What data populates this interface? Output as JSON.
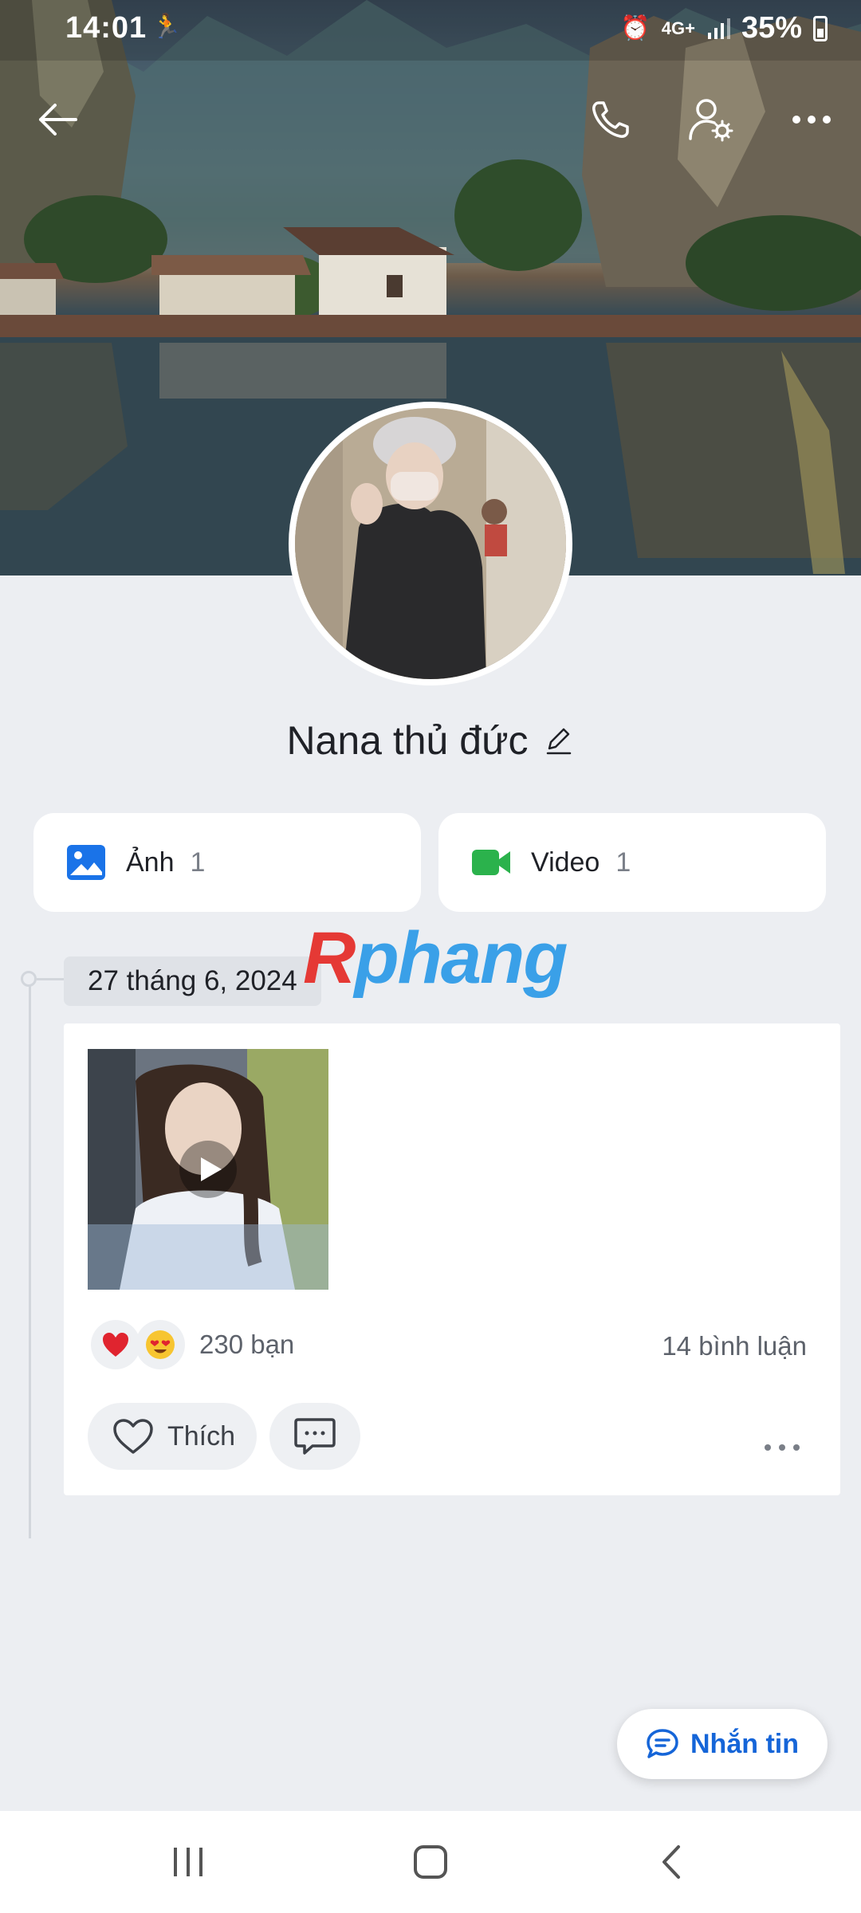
{
  "status_bar": {
    "time": "14:01",
    "battery": "35%",
    "network": "4G+"
  },
  "profile": {
    "name": "Nana thủ đức"
  },
  "media": {
    "photos": {
      "label": "Ảnh",
      "count": "1"
    },
    "videos": {
      "label": "Video",
      "count": "1"
    }
  },
  "timeline": {
    "date": "27 tháng 6, 2024",
    "post": {
      "reactions_count": "230 bạn",
      "comments": "14 bình luận",
      "like_label": "Thích",
      "reactions": [
        "heart",
        "heart-eyes"
      ]
    }
  },
  "watermark": {
    "first": "R",
    "rest": "phang"
  },
  "fab": {
    "label": "Nhắn tin"
  },
  "colors": {
    "accent": "#1565d8",
    "photo_icon": "#1a73e8",
    "video_icon": "#2bb24c",
    "background": "#eceef2"
  }
}
